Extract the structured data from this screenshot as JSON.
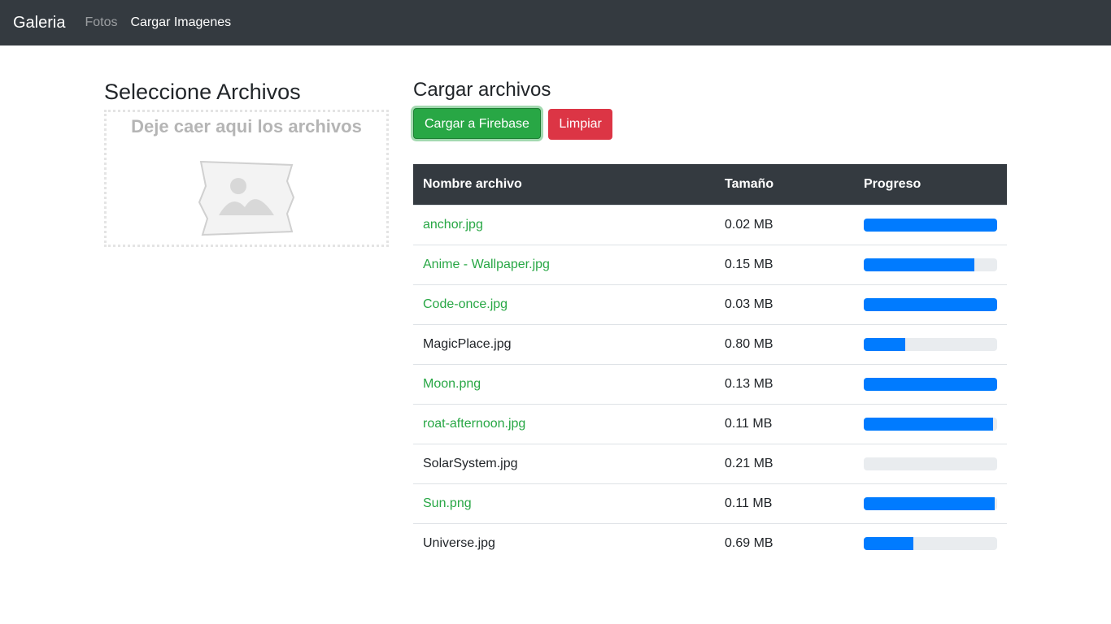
{
  "navbar": {
    "brand": "Galeria",
    "links": [
      {
        "label": "Fotos",
        "active": false
      },
      {
        "label": "Cargar Imagenes",
        "active": true
      }
    ]
  },
  "left": {
    "title": "Seleccione Archivos",
    "drop_text": "Deje caer aqui los archivos",
    "icon": "image-placeholder-icon"
  },
  "right": {
    "title": "Cargar archivos",
    "buttons": {
      "upload": "Cargar a Firebase",
      "clear": "Limpiar"
    },
    "table": {
      "headers": [
        "Nombre archivo",
        "Tamaño",
        "Progreso"
      ],
      "rows": [
        {
          "name": "anchor.jpg",
          "size": "0.02 MB",
          "progress": 100,
          "status": "success"
        },
        {
          "name": "Anime - Wallpaper.jpg",
          "size": "0.15 MB",
          "progress": 83,
          "status": "success"
        },
        {
          "name": "Code-once.jpg",
          "size": "0.03 MB",
          "progress": 100,
          "status": "success"
        },
        {
          "name": "MagicPlace.jpg",
          "size": "0.80 MB",
          "progress": 31,
          "status": "normal"
        },
        {
          "name": "Moon.png",
          "size": "0.13 MB",
          "progress": 100,
          "status": "success"
        },
        {
          "name": "roat-afternoon.jpg",
          "size": "0.11 MB",
          "progress": 97,
          "status": "success"
        },
        {
          "name": "SolarSystem.jpg",
          "size": "0.21 MB",
          "progress": 0,
          "status": "normal"
        },
        {
          "name": "Sun.png",
          "size": "0.11 MB",
          "progress": 98,
          "status": "success"
        },
        {
          "name": "Universe.jpg",
          "size": "0.69 MB",
          "progress": 37,
          "status": "normal"
        }
      ]
    }
  },
  "colors": {
    "navbar": "#343a40",
    "success": "#28a745",
    "danger": "#dc3545",
    "progress": "#007bff"
  }
}
